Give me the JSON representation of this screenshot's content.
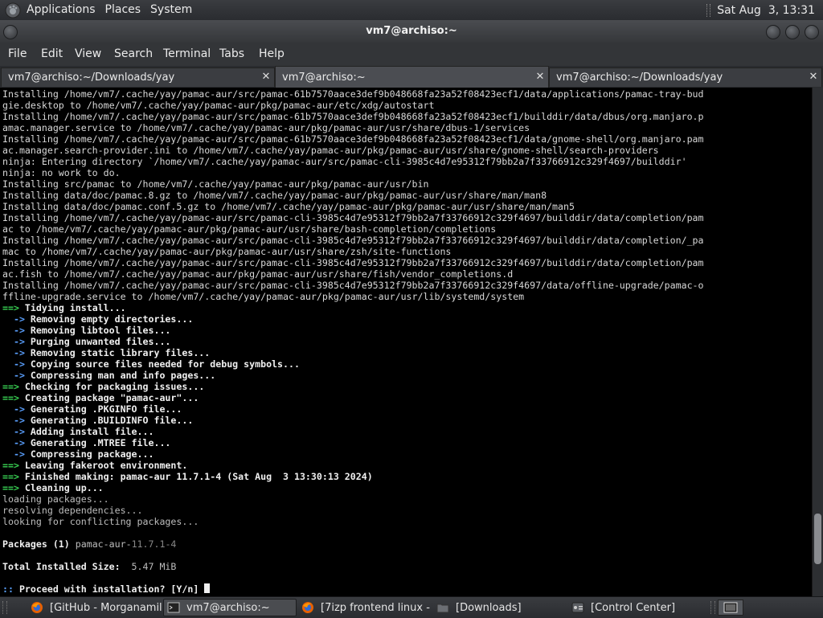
{
  "top_panel": {
    "menus": [
      "Applications",
      "Places",
      "System"
    ],
    "clock": "Sat Aug  3, 13:31"
  },
  "window": {
    "title": "vm7@archiso:~"
  },
  "menubar": [
    "File",
    "Edit",
    "View",
    "Search",
    "Terminal",
    "Tabs",
    "Help"
  ],
  "tabs": [
    {
      "label": "vm7@archiso:~/Downloads/yay",
      "active": false
    },
    {
      "label": "vm7@archiso:~",
      "active": true
    },
    {
      "label": "vm7@archiso:~/Downloads/yay",
      "active": false
    }
  ],
  "terminal": {
    "lines": [
      {
        "t": "plain",
        "text": "Installing /home/vm7/.cache/yay/pamac-aur/src/pamac-61b7570aace3def9b048668fa23a52f08423ecf1/data/applications/pamac-tray-bud"
      },
      {
        "t": "plain",
        "text": "gie.desktop to /home/vm7/.cache/yay/pamac-aur/pkg/pamac-aur/etc/xdg/autostart"
      },
      {
        "t": "plain",
        "text": "Installing /home/vm7/.cache/yay/pamac-aur/src/pamac-61b7570aace3def9b048668fa23a52f08423ecf1/builddir/data/dbus/org.manjaro.p"
      },
      {
        "t": "plain",
        "text": "amac.manager.service to /home/vm7/.cache/yay/pamac-aur/pkg/pamac-aur/usr/share/dbus-1/services"
      },
      {
        "t": "plain",
        "text": "Installing /home/vm7/.cache/yay/pamac-aur/src/pamac-61b7570aace3def9b048668fa23a52f08423ecf1/data/gnome-shell/org.manjaro.pam"
      },
      {
        "t": "plain",
        "text": "ac.manager.search-provider.ini to /home/vm7/.cache/yay/pamac-aur/pkg/pamac-aur/usr/share/gnome-shell/search-providers"
      },
      {
        "t": "plain",
        "text": "ninja: Entering directory `/home/vm7/.cache/yay/pamac-aur/src/pamac-cli-3985c4d7e95312f79bb2a7f33766912c329f4697/builddir'"
      },
      {
        "t": "plain",
        "text": "ninja: no work to do."
      },
      {
        "t": "plain",
        "text": "Installing src/pamac to /home/vm7/.cache/yay/pamac-aur/pkg/pamac-aur/usr/bin"
      },
      {
        "t": "plain",
        "text": "Installing data/doc/pamac.8.gz to /home/vm7/.cache/yay/pamac-aur/pkg/pamac-aur/usr/share/man/man8"
      },
      {
        "t": "plain",
        "text": "Installing data/doc/pamac.conf.5.gz to /home/vm7/.cache/yay/pamac-aur/pkg/pamac-aur/usr/share/man/man5"
      },
      {
        "t": "plain",
        "text": "Installing /home/vm7/.cache/yay/pamac-aur/src/pamac-cli-3985c4d7e95312f79bb2a7f33766912c329f4697/builddir/data/completion/pam"
      },
      {
        "t": "plain",
        "text": "ac to /home/vm7/.cache/yay/pamac-aur/pkg/pamac-aur/usr/share/bash-completion/completions"
      },
      {
        "t": "plain",
        "text": "Installing /home/vm7/.cache/yay/pamac-aur/src/pamac-cli-3985c4d7e95312f79bb2a7f33766912c329f4697/builddir/data/completion/_pa"
      },
      {
        "t": "plain",
        "text": "mac to /home/vm7/.cache/yay/pamac-aur/pkg/pamac-aur/usr/share/zsh/site-functions"
      },
      {
        "t": "plain",
        "text": "Installing /home/vm7/.cache/yay/pamac-aur/src/pamac-cli-3985c4d7e95312f79bb2a7f33766912c329f4697/builddir/data/completion/pam"
      },
      {
        "t": "plain",
        "text": "ac.fish to /home/vm7/.cache/yay/pamac-aur/pkg/pamac-aur/usr/share/fish/vendor_completions.d"
      },
      {
        "t": "plain",
        "text": "Installing /home/vm7/.cache/yay/pamac-aur/src/pamac-cli-3985c4d7e95312f79bb2a7f33766912c329f4697/data/offline-upgrade/pamac-o"
      },
      {
        "t": "plain",
        "text": "ffline-upgrade.service to /home/vm7/.cache/yay/pamac-aur/pkg/pamac-aur/usr/lib/systemd/system"
      },
      {
        "t": "green",
        "prefix": "==>",
        "text": " Tidying install..."
      },
      {
        "t": "blue",
        "prefix": "  ->",
        "text": " Removing empty directories..."
      },
      {
        "t": "blue",
        "prefix": "  ->",
        "text": " Removing libtool files..."
      },
      {
        "t": "blue",
        "prefix": "  ->",
        "text": " Purging unwanted files..."
      },
      {
        "t": "blue",
        "prefix": "  ->",
        "text": " Removing static library files..."
      },
      {
        "t": "blue",
        "prefix": "  ->",
        "text": " Copying source files needed for debug symbols..."
      },
      {
        "t": "blue",
        "prefix": "  ->",
        "text": " Compressing man and info pages..."
      },
      {
        "t": "green",
        "prefix": "==>",
        "text": " Checking for packaging issues..."
      },
      {
        "t": "green",
        "prefix": "==>",
        "text": " Creating package \"pamac-aur\"..."
      },
      {
        "t": "blue",
        "prefix": "  ->",
        "text": " Generating .PKGINFO file..."
      },
      {
        "t": "blue",
        "prefix": "  ->",
        "text": " Generating .BUILDINFO file..."
      },
      {
        "t": "blue",
        "prefix": "  ->",
        "text": " Adding install file..."
      },
      {
        "t": "blue",
        "prefix": "  ->",
        "text": " Generating .MTREE file..."
      },
      {
        "t": "blue",
        "prefix": "  ->",
        "text": " Compressing package..."
      },
      {
        "t": "green",
        "prefix": "==>",
        "text": " Leaving fakeroot environment."
      },
      {
        "t": "green",
        "prefix": "==>",
        "text": " Finished making: pamac-aur 11.7.1-4 (Sat Aug  3 13:30:13 2024)"
      },
      {
        "t": "green",
        "prefix": "==>",
        "text": " Cleaning up..."
      },
      {
        "t": "muted",
        "text": "loading packages..."
      },
      {
        "t": "muted",
        "text": "resolving dependencies..."
      },
      {
        "t": "muted",
        "text": "looking for conflicting packages..."
      },
      {
        "t": "plain",
        "text": ""
      },
      {
        "t": "pkg",
        "label": "Packages (1) ",
        "name": "pamac-aur-",
        "version": "11.7.1-4"
      },
      {
        "t": "plain",
        "text": ""
      },
      {
        "t": "size",
        "label": "Total Installed Size:",
        "value": "  5.47 MiB"
      },
      {
        "t": "plain",
        "text": ""
      },
      {
        "t": "prompt",
        "prefix": "::",
        "text": " Proceed with installation? [Y/n] "
      }
    ],
    "scroll_position": 0.93,
    "scroll_visible_fraction": 0.1
  },
  "taskbar": {
    "items": [
      {
        "label": "[GitHub - Morganamil...",
        "icon": "firefox-icon",
        "active": false
      },
      {
        "label": "vm7@archiso:~",
        "icon": "terminal-icon",
        "active": true
      },
      {
        "label": "[7izp frontend linux - ...",
        "icon": "firefox-icon",
        "active": false
      },
      {
        "label": "[Downloads]",
        "icon": "folder-icon",
        "active": false
      },
      {
        "label": "[Control Center]",
        "icon": "control-center-icon",
        "active": false
      }
    ]
  }
}
